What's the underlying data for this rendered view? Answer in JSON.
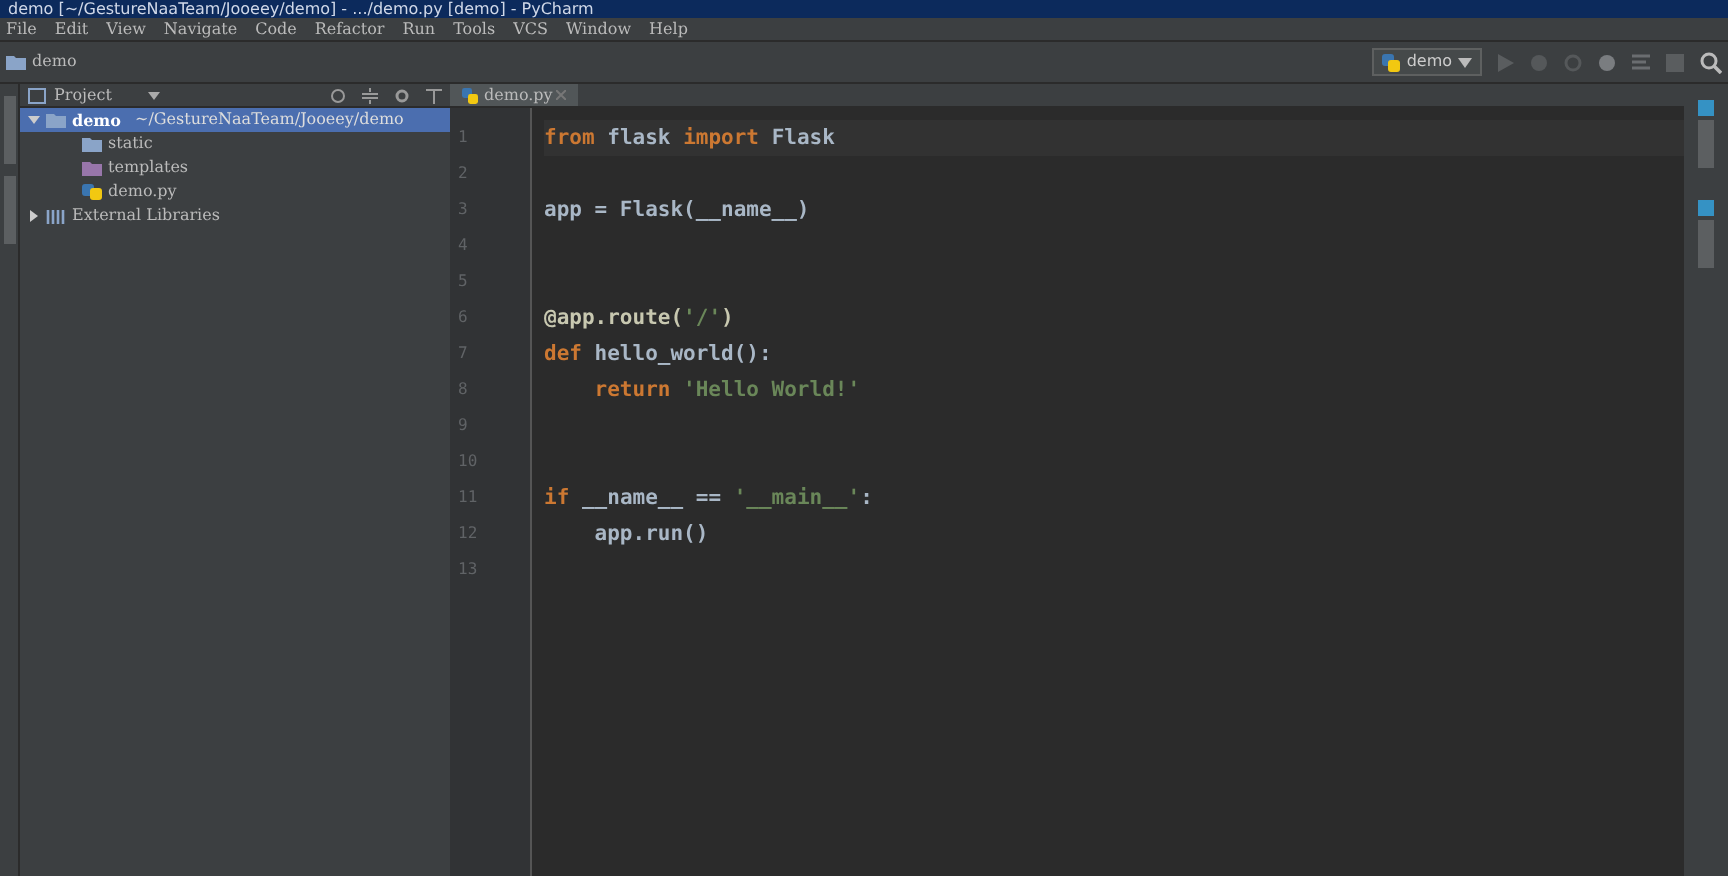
{
  "window": {
    "title": "demo [~/GestureNaaTeam/Jooeey/demo] - .../demo.py [demo] - PyCharm"
  },
  "menu": [
    "File",
    "Edit",
    "View",
    "Navigate",
    "Code",
    "Refactor",
    "Run",
    "Tools",
    "VCS",
    "Window",
    "Help"
  ],
  "breadcrumb": "demo",
  "run_config": "demo",
  "project_panel": {
    "title": "Project",
    "tree": [
      {
        "label": "demo",
        "path": "~/GestureNaaTeam/Jooeey/demo",
        "kind": "folder",
        "expanded": true,
        "selected": true,
        "children": [
          {
            "label": "static",
            "kind": "folder",
            "selected": false
          },
          {
            "label": "templates",
            "kind": "template-folder",
            "selected": false
          },
          {
            "label": "demo.py",
            "kind": "python",
            "selected": false
          }
        ]
      },
      {
        "label": "External Libraries",
        "kind": "library",
        "expanded": false,
        "selected": false
      }
    ]
  },
  "editor": {
    "tabs": [
      {
        "label": "demo.py",
        "selected": true
      }
    ],
    "lines": [
      {
        "number": "1",
        "tokens": [
          {
            "kind": "keyword",
            "text": "from"
          },
          {
            "kind": "plain",
            "text": " flask "
          },
          {
            "kind": "keyword",
            "text": "import"
          },
          {
            "kind": "plain",
            "text": " Flask"
          }
        ]
      },
      {
        "number": "2"
      },
      {
        "number": "3",
        "tokens": [
          {
            "kind": "plain",
            "text": "app = Flask(__name__)"
          }
        ]
      },
      {
        "number": "4"
      },
      {
        "number": "5"
      },
      {
        "number": "6",
        "tokens": [
          {
            "kind": "decorator",
            "text": "@app.route("
          },
          {
            "kind": "string",
            "text": "'/'"
          },
          {
            "kind": "decorator",
            "text": ")"
          }
        ]
      },
      {
        "number": "7",
        "tokens": [
          {
            "kind": "keyword",
            "text": "def"
          },
          {
            "kind": "plain",
            "text": " hello_world():"
          }
        ]
      },
      {
        "number": "8",
        "indent": true,
        "tokens": [
          {
            "kind": "keyword",
            "text": "return"
          },
          {
            "kind": "string",
            "text": " 'Hello World!'"
          }
        ]
      },
      {
        "number": "9"
      },
      {
        "number": "10"
      },
      {
        "number": "11",
        "tokens": [
          {
            "kind": "keyword",
            "text": "if"
          },
          {
            "kind": "plain",
            "text": " __name__ == "
          },
          {
            "kind": "string",
            "text": "'__main__'"
          },
          {
            "kind": "plain",
            "text": ":"
          }
        ]
      },
      {
        "number": "12",
        "indent": true,
        "tokens": [
          {
            "kind": "plain",
            "text": "app.run()"
          }
        ]
      },
      {
        "number": "13"
      }
    ]
  }
}
